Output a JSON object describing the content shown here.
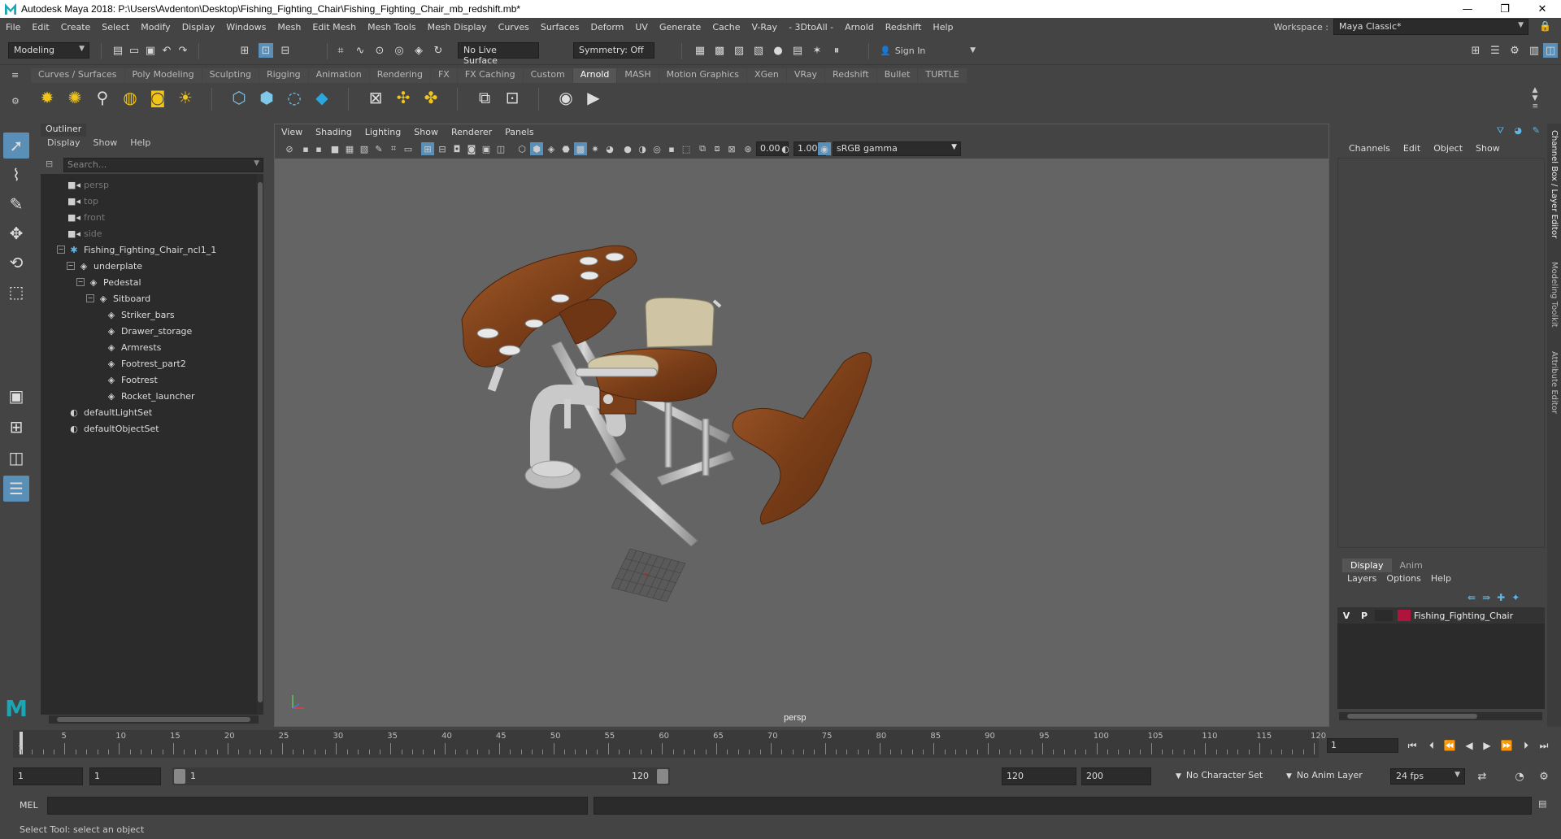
{
  "window": {
    "title": "Autodesk Maya 2018: P:\\Users\\Avdenton\\Desktop\\Fishing_Fighting_Chair\\Fishing_Fighting_Chair_mb_redshift.mb*",
    "minimize": "—",
    "maximize": "❐",
    "close": "✕"
  },
  "menubar": {
    "items": [
      "File",
      "Edit",
      "Create",
      "Select",
      "Modify",
      "Display",
      "Windows",
      "Mesh",
      "Edit Mesh",
      "Mesh Tools",
      "Mesh Display",
      "Curves",
      "Surfaces",
      "Deform",
      "UV",
      "Generate",
      "Cache",
      "V-Ray",
      "- 3DtoAll -",
      "Arnold",
      "Redshift",
      "Help"
    ],
    "workspace_label": "Workspace :",
    "workspace_value": "Maya Classic*"
  },
  "statusline": {
    "mode": "Modeling",
    "live_surface": "No Live Surface",
    "symmetry": "Symmetry: Off",
    "sign_in": "Sign In"
  },
  "shelf": {
    "tabs": [
      "Curves / Surfaces",
      "Poly Modeling",
      "Sculpting",
      "Rigging",
      "Animation",
      "Rendering",
      "FX",
      "FX Caching",
      "Custom",
      "Arnold",
      "MASH",
      "Motion Graphics",
      "XGen",
      "VRay",
      "Redshift",
      "Bullet",
      "TURTLE"
    ],
    "active_tab": "Arnold"
  },
  "outliner": {
    "title": "Outliner",
    "menus": [
      "Display",
      "Show",
      "Help"
    ],
    "search_placeholder": "Search...",
    "items": [
      {
        "label": "persp",
        "icon": "camera-icon",
        "dim": true
      },
      {
        "label": "top",
        "icon": "camera-icon",
        "dim": true
      },
      {
        "label": "front",
        "icon": "camera-icon",
        "dim": true
      },
      {
        "label": "side",
        "icon": "camera-icon",
        "dim": true
      },
      {
        "label": "Fishing_Fighting_Chair_ncl1_1",
        "icon": "asterisk-icon",
        "dim": false
      },
      {
        "label": "underplate",
        "icon": "mesh-icon",
        "dim": false
      },
      {
        "label": "Pedestal",
        "icon": "mesh-icon",
        "dim": false
      },
      {
        "label": "Sitboard",
        "icon": "mesh-icon",
        "dim": false
      },
      {
        "label": "Striker_bars",
        "icon": "mesh-icon",
        "dim": false
      },
      {
        "label": "Drawer_storage",
        "icon": "mesh-icon",
        "dim": false
      },
      {
        "label": "Armrests",
        "icon": "mesh-icon",
        "dim": false
      },
      {
        "label": "Footrest_part2",
        "icon": "mesh-icon",
        "dim": false
      },
      {
        "label": "Footrest",
        "icon": "mesh-icon",
        "dim": false
      },
      {
        "label": "Rocket_launcher",
        "icon": "mesh-icon",
        "dim": false
      },
      {
        "label": "defaultLightSet",
        "icon": "set-icon",
        "dim": false
      },
      {
        "label": "defaultObjectSet",
        "icon": "set-icon",
        "dim": false
      }
    ]
  },
  "viewport": {
    "menus": [
      "View",
      "Shading",
      "Lighting",
      "Show",
      "Renderer",
      "Panels"
    ],
    "exposure": "0.00",
    "gamma": "1.00",
    "color_space": "sRGB gamma",
    "camera": "persp"
  },
  "channelbox": {
    "menus": [
      "Channels",
      "Edit",
      "Object",
      "Show"
    ],
    "layer_tabs": [
      "Display",
      "Anim"
    ],
    "active_layer_tab": "Display",
    "layer_menus": [
      "Layers",
      "Options",
      "Help"
    ],
    "layer": {
      "v": "V",
      "p": "P",
      "name": "Fishing_Fighting_Chair",
      "color": "#b0143c"
    }
  },
  "side_tabs": [
    "Channel Box / Layer Editor",
    "Modeling Toolkit",
    "Attribute Editor"
  ],
  "timeline": {
    "labels": [
      "5",
      "10",
      "15",
      "20",
      "25",
      "30",
      "35",
      "40",
      "45",
      "50",
      "55",
      "60",
      "65",
      "70",
      "75",
      "80",
      "85",
      "90",
      "95",
      "100",
      "105",
      "110",
      "115",
      "120"
    ],
    "start_label": "1",
    "current_frame": "1"
  },
  "range": {
    "start": "1",
    "playback_start": "1",
    "slider_start": "1",
    "slider_end": "120",
    "playback_end": "120",
    "end": "200",
    "character_set": "No Character Set",
    "anim_layer": "No Anim Layer",
    "fps": "24 fps"
  },
  "commandline": {
    "lang": "MEL"
  },
  "helpline": "Select Tool: select an object"
}
